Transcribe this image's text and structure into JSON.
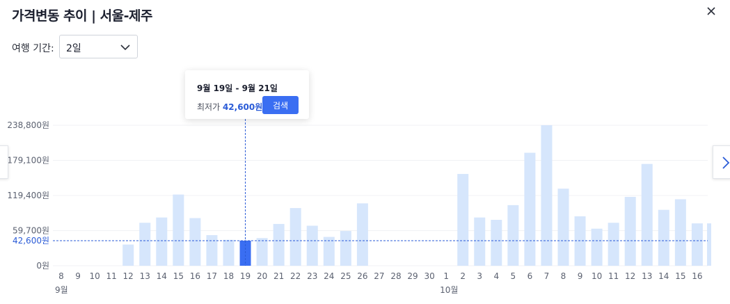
{
  "header": {
    "title": "가격변동 추이 | 서울-제주"
  },
  "filter": {
    "period_label": "여행 기간:",
    "period_value": "2일"
  },
  "tooltip": {
    "range": "9월 19일 - 9월 21일",
    "lowest_label": "최저가",
    "lowest_price": "42,600원",
    "search_label": "검색"
  },
  "icons": {
    "close": "close-icon",
    "dropdown": "chevron-down-icon",
    "next": "chevron-right-icon"
  },
  "colors": {
    "bar": "#d6e6fc",
    "selected_bar": "#3a6ef2",
    "accent": "#2a5bd7",
    "grid": "#f0f1f4",
    "axis_text": "#5b6170"
  },
  "chart_data": {
    "type": "bar",
    "xlabel": "",
    "ylabel": "",
    "categories": [
      "8",
      "9",
      "10",
      "11",
      "12",
      "13",
      "14",
      "15",
      "16",
      "17",
      "18",
      "19",
      "20",
      "21",
      "22",
      "23",
      "24",
      "25",
      "26",
      "27",
      "28",
      "29",
      "30",
      "1",
      "2",
      "3",
      "4",
      "5",
      "6",
      "7",
      "8",
      "9",
      "10",
      "11",
      "12",
      "13",
      "14",
      "15",
      "16"
    ],
    "month_labels": [
      {
        "label": "9월",
        "at_index": 0
      },
      {
        "label": "10월",
        "at_index": 23
      }
    ],
    "values": [
      null,
      null,
      null,
      null,
      36000,
      73000,
      82000,
      121000,
      81000,
      52000,
      44000,
      42600,
      47000,
      71000,
      98000,
      68000,
      49000,
      59000,
      106000,
      null,
      null,
      null,
      null,
      null,
      156000,
      82000,
      78000,
      103000,
      192000,
      238800,
      131000,
      84000,
      63000,
      73000,
      117000,
      173000,
      95000,
      113000,
      72000
    ],
    "ylim": [
      0,
      238800
    ],
    "yticks": [
      0,
      59700,
      119400,
      179100,
      238800
    ],
    "ytick_labels": [
      "0원",
      "59,700원",
      "119,400원",
      "179,100원",
      "238,800원"
    ],
    "selected_index": 11,
    "reference_line": {
      "value": 42600,
      "label": "42,600원"
    },
    "grid": true
  }
}
